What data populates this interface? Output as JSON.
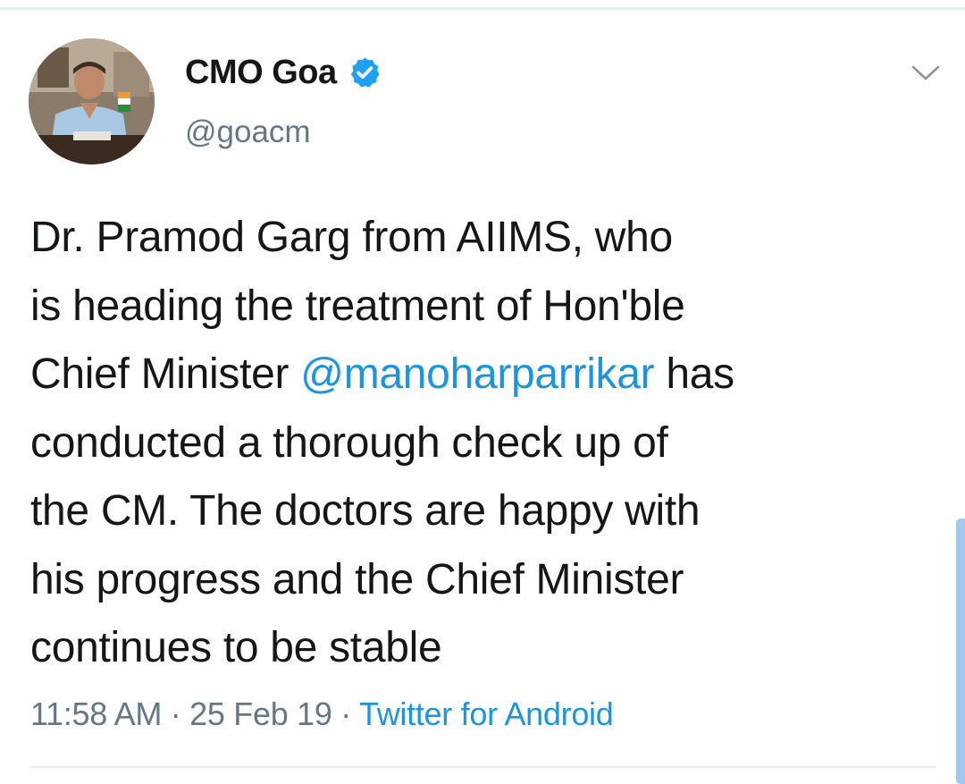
{
  "tweet": {
    "author": {
      "display_name": "CMO Goa",
      "handle": "@goacm",
      "verified": true,
      "avatar_icon": "profile-photo"
    },
    "text_lines": [
      {
        "parts": [
          "Dr. Pramod Garg from AIIMS, who"
        ]
      },
      {
        "parts": [
          "is heading the treatment of Hon'ble"
        ]
      },
      {
        "pre": "Chief Minister ",
        "mention": "@manoharparrikar",
        "post": " has"
      },
      {
        "parts": [
          "conducted a thorough check up of"
        ]
      },
      {
        "parts": [
          "the CM. The doctors are happy with"
        ]
      },
      {
        "parts": [
          "his progress and the Chief Minister"
        ]
      },
      {
        "parts": [
          "continues to be stable"
        ]
      }
    ],
    "time": "11:58 AM",
    "separator": " · ",
    "date": "25 Feb 19",
    "source": "Twitter for Android",
    "menu_icon": "chevron-down-icon"
  },
  "colors": {
    "link": "#1b95e0",
    "text": "#14171a",
    "muted": "#657786",
    "divider": "#e6ecf0"
  }
}
